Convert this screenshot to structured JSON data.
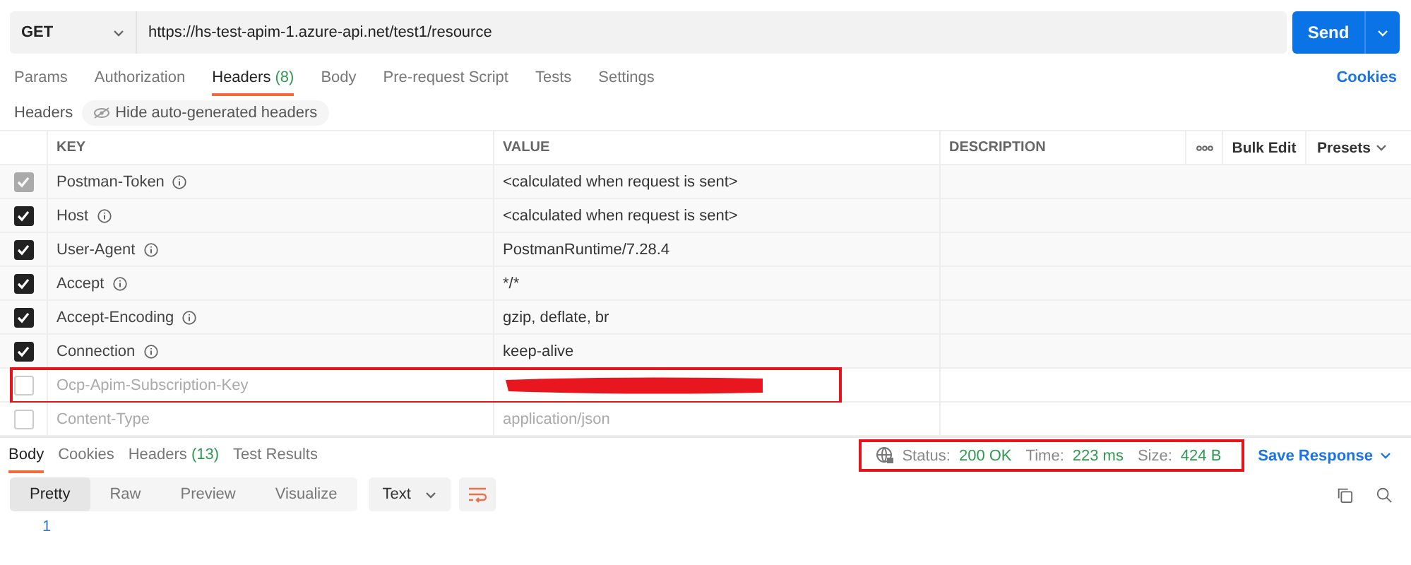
{
  "request": {
    "method": "GET",
    "url": "https://hs-test-apim-1.azure-api.net/test1/resource",
    "send": "Send"
  },
  "tabs": [
    {
      "label": "Params",
      "selected": false
    },
    {
      "label": "Authorization",
      "selected": false
    },
    {
      "label": "Headers",
      "count": "(8)",
      "selected": true
    },
    {
      "label": "Body",
      "selected": false
    },
    {
      "label": "Pre-request Script",
      "selected": false
    },
    {
      "label": "Tests",
      "selected": false
    },
    {
      "label": "Settings",
      "selected": false
    }
  ],
  "cookies_link": "Cookies",
  "headers_bar": {
    "label": "Headers",
    "toggle": "Hide auto-generated headers"
  },
  "table": {
    "columns": [
      "KEY",
      "VALUE",
      "DESCRIPTION"
    ],
    "bulk_edit": "Bulk Edit",
    "presets": "Presets",
    "rows": [
      {
        "key": "Postman-Token",
        "value": "<calculated when request is sent>",
        "checked": true,
        "disabled": true,
        "info": true
      },
      {
        "key": "Host",
        "value": "<calculated when request is sent>",
        "checked": true,
        "info": true
      },
      {
        "key": "User-Agent",
        "value": "PostmanRuntime/7.28.4",
        "checked": true,
        "info": true
      },
      {
        "key": "Accept",
        "value": "*/*",
        "checked": true,
        "info": true
      },
      {
        "key": "Accept-Encoding",
        "value": "gzip, deflate, br",
        "checked": true,
        "info": true
      },
      {
        "key": "Connection",
        "value": "keep-alive",
        "checked": true,
        "info": true
      },
      {
        "key": "Ocp-Apim-Subscription-Key",
        "checked": false,
        "highlighted": true,
        "redacted": true
      },
      {
        "key": "Content-Type",
        "value": "application/json",
        "checked": false
      }
    ]
  },
  "response": {
    "tabs": [
      {
        "label": "Body",
        "selected": true
      },
      {
        "label": "Cookies",
        "selected": false
      },
      {
        "label": "Headers",
        "count": "(13)",
        "selected": false
      },
      {
        "label": "Test Results",
        "selected": false
      }
    ],
    "status": {
      "highlighted": true,
      "items": [
        {
          "label": "Status:",
          "value": "200 OK"
        },
        {
          "label": "Time:",
          "value": "223 ms"
        },
        {
          "label": "Size:",
          "value": "424 B"
        }
      ]
    },
    "save": "Save Response",
    "view_modes": [
      {
        "label": "Pretty",
        "selected": true
      },
      {
        "label": "Raw",
        "selected": false
      },
      {
        "label": "Preview",
        "selected": false
      },
      {
        "label": "Visualize",
        "selected": false
      }
    ],
    "format": "Text",
    "lines": [
      "1"
    ]
  }
}
